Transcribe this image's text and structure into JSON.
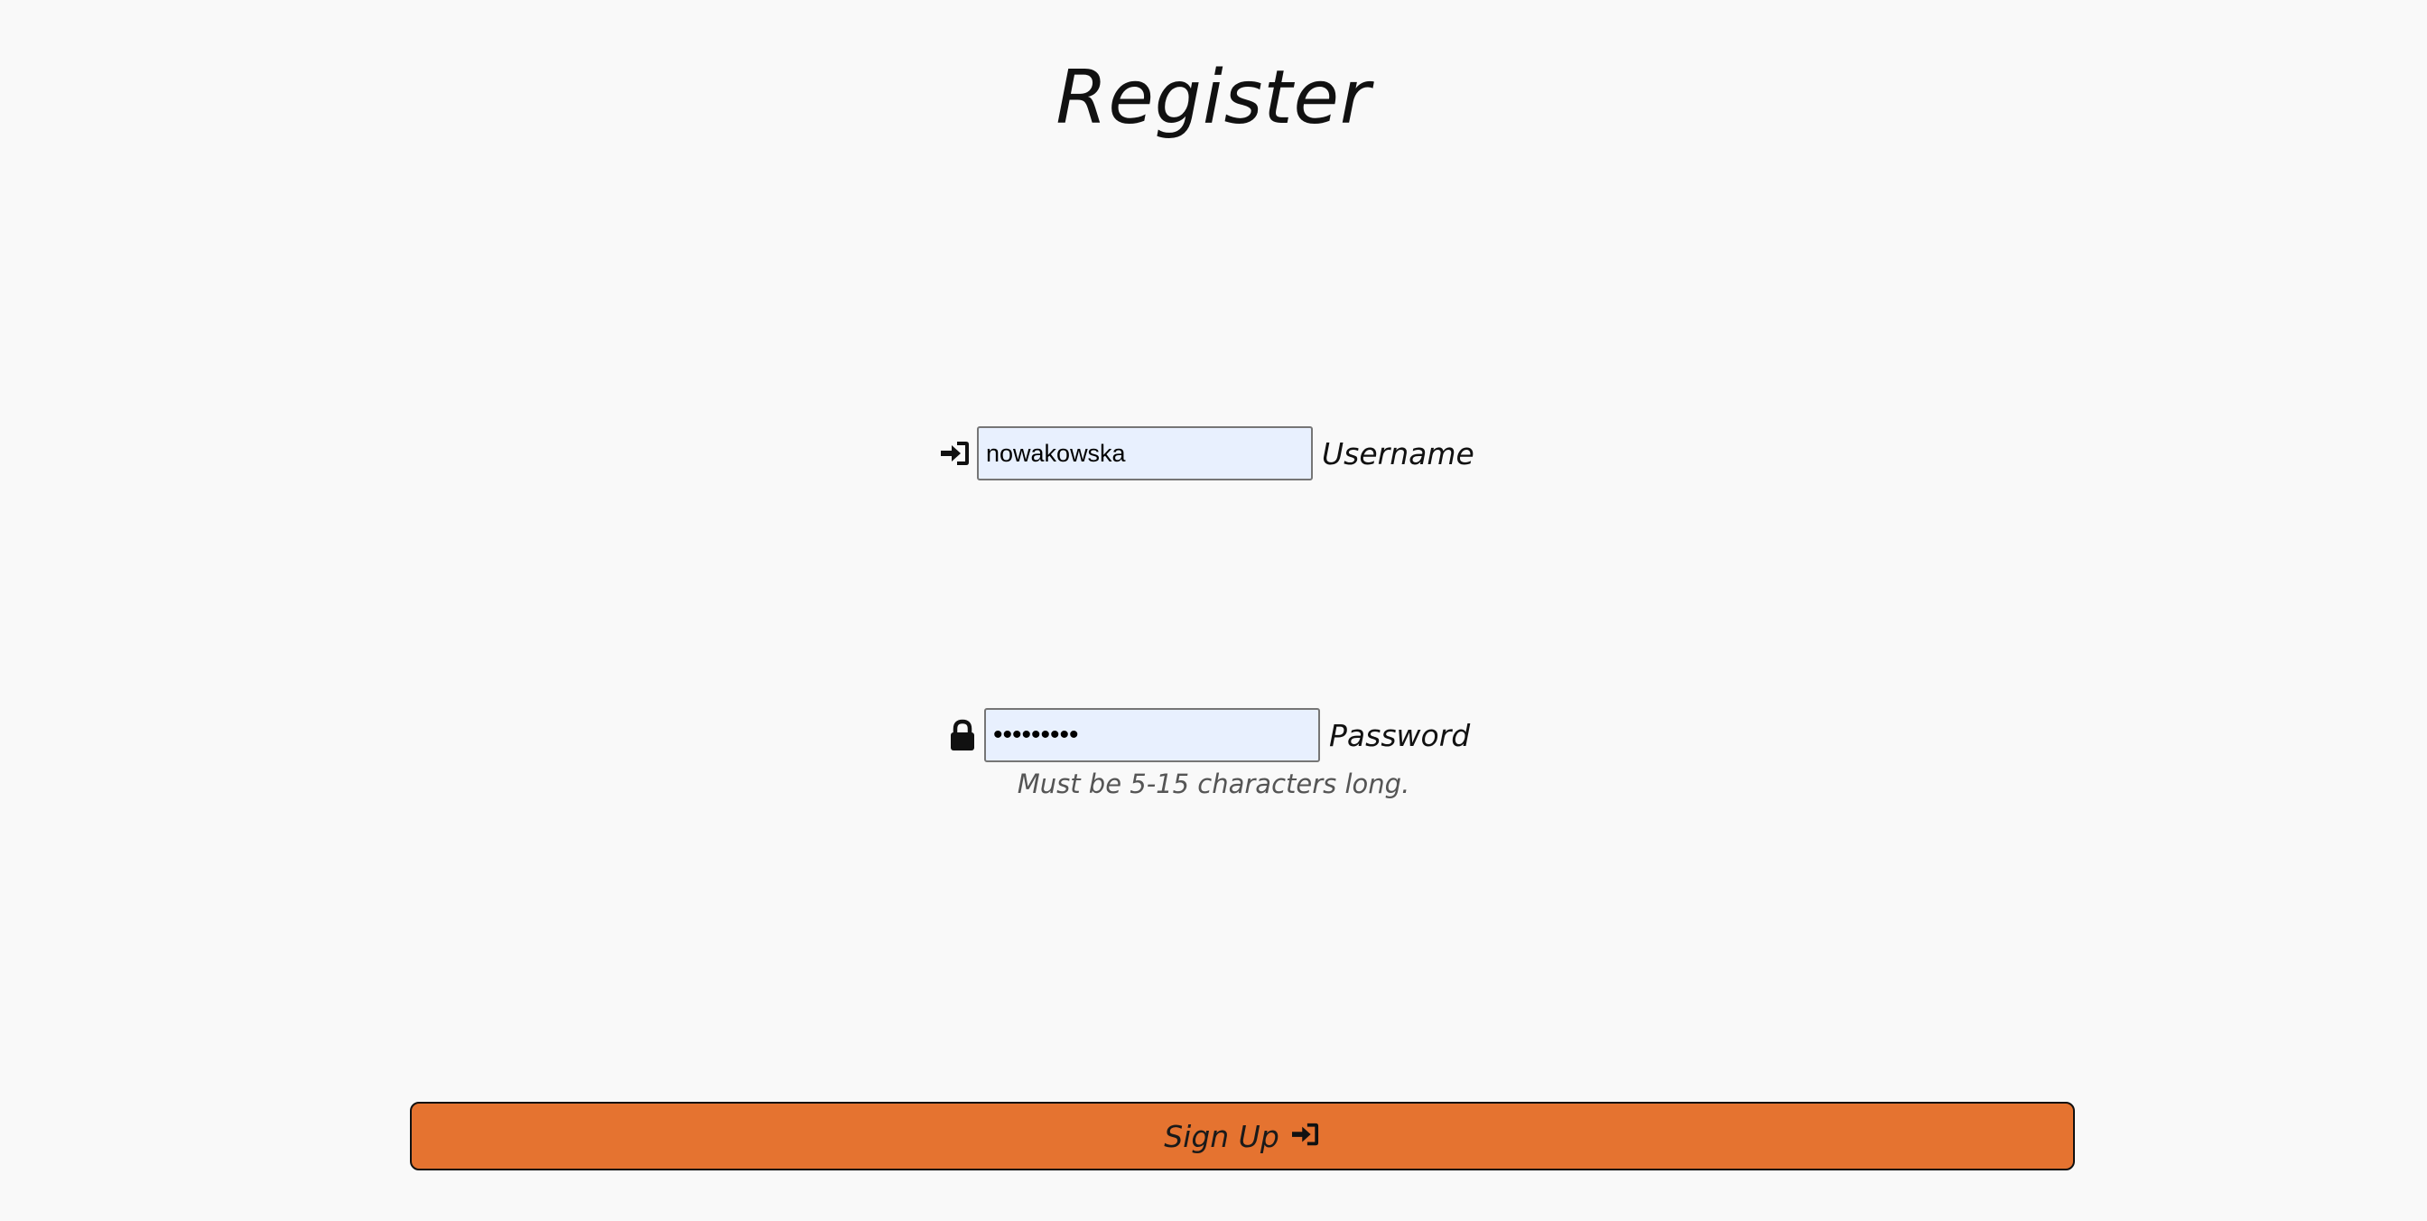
{
  "page": {
    "title": "Register"
  },
  "form": {
    "username": {
      "value": "nowakowska",
      "label": "Username",
      "icon": "sign-in-icon"
    },
    "password": {
      "value": "•••••••••",
      "label": "Password",
      "icon": "lock-icon",
      "hint": "Must be 5-15 characters long."
    },
    "submit": {
      "label": "Sign Up",
      "icon": "sign-in-icon"
    }
  },
  "colors": {
    "background": "#f9f9f9",
    "input_fill": "#e8f0fe",
    "button": "#e57330"
  }
}
